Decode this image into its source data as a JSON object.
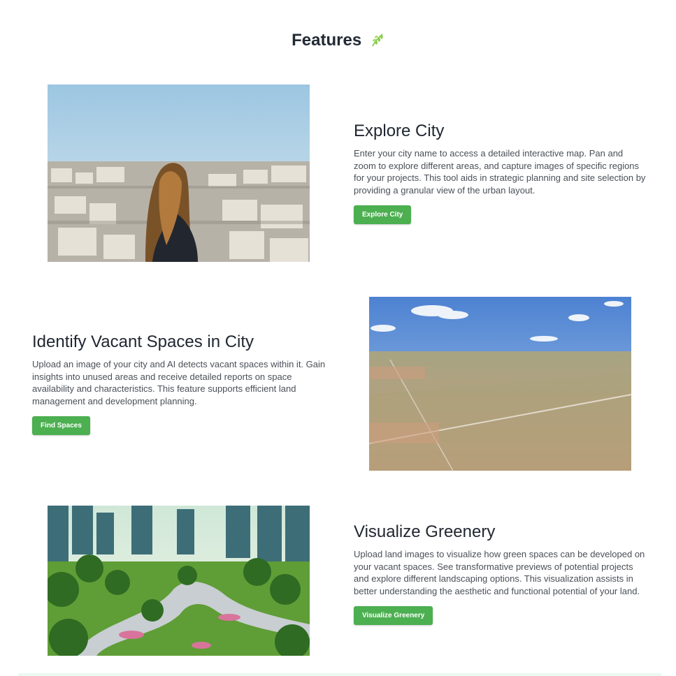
{
  "header": {
    "title": "Features",
    "icon": "leaf-icon",
    "icon_color": "#7cc342"
  },
  "features": [
    {
      "title": "Explore City",
      "description": "Enter your city name to access a detailed interactive map. Pan and zoom to explore different areas, and capture images of specific regions for your projects. This tool aids in strategic planning and site selection by providing a granular view of the urban layout.",
      "button_label": "Explore City",
      "image": "city-panorama-photo"
    },
    {
      "title": "Identify Vacant Spaces in City",
      "description": "Upload an image of your city and AI detects vacant spaces within it. Gain insights into unused areas and receive detailed reports on space availability and characteristics. This feature supports efficient land management and development planning.",
      "button_label": "Find Spaces",
      "image": "vacant-land-photo"
    },
    {
      "title": "Visualize Greenery",
      "description": "Upload land images to visualize how green spaces can be developed on your vacant spaces. See transformative previews of potential projects and explore different landscaping options. This visualization assists in better understanding the aesthetic and functional potential of your land.",
      "button_label": "Visualize Greenery",
      "image": "green-park-illustration"
    }
  ],
  "colors": {
    "button": "#4caf50",
    "heading": "#1f2630",
    "body_text": "#4a4f57"
  }
}
